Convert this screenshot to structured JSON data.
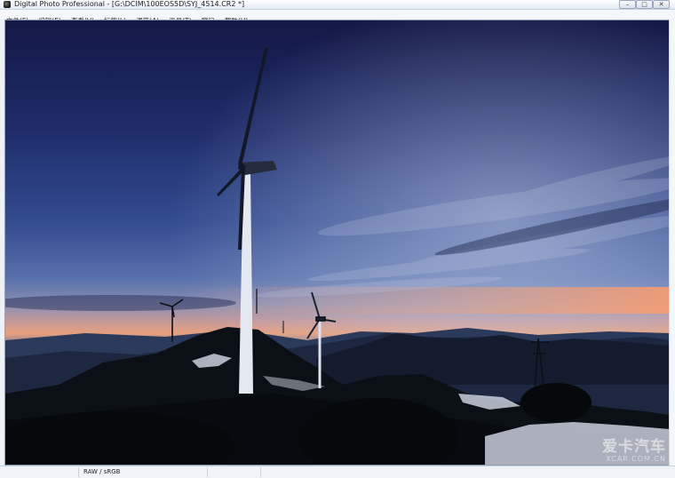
{
  "window": {
    "title": "Digital Photo Professional - [G:\\DCIM\\100EOS5D\\SYJ_4514.CR2 *]",
    "icon": "camera-app-icon",
    "minimize_label": "–",
    "maximize_label": "□",
    "close_label": "✕"
  },
  "menu": {
    "items": [
      {
        "label": "文件(F)"
      },
      {
        "label": "编辑(E)"
      },
      {
        "label": "查看(V)"
      },
      {
        "label": "标签(L)"
      },
      {
        "label": "调节(A)"
      },
      {
        "label": "工具(T)"
      },
      {
        "label": "窗口"
      },
      {
        "label": "帮助(H)"
      }
    ]
  },
  "status": {
    "color_mode": "RAW / sRGB"
  },
  "watermark": {
    "brand_cn": "爱卡汽车",
    "brand_en": "XCAR.COM.CN"
  },
  "colors": {
    "sky_top": "#141a4a",
    "sky_mid": "#3a4f8d",
    "horizon_glow": "#f0a27a",
    "silhouette": "#0a0d10"
  }
}
